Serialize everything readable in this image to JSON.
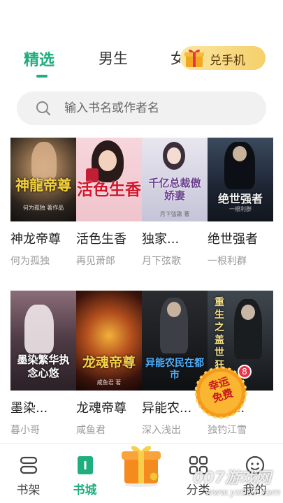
{
  "tabs": [
    {
      "label": "精选",
      "active": true
    },
    {
      "label": "男生",
      "active": false
    }
  ],
  "redeem_button": {
    "label": "兑手机"
  },
  "search": {
    "placeholder": "输入书名或作者名"
  },
  "books": [
    {
      "title": "神龙帝尊",
      "author": "何为孤独",
      "cover_text": "神龍帝尊",
      "cover_sub": "何为孤独 著作品"
    },
    {
      "title": "活色生香",
      "author": "再见萧郎",
      "cover_text": "活色生香",
      "cover_sub": ""
    },
    {
      "title": "独家...",
      "author": "月下弦歌",
      "cover_text": "千亿总裁傲娇妻",
      "cover_sub": "月下弦歌 著"
    },
    {
      "title": "绝世强者",
      "author": "一根利群",
      "cover_text": "绝世强者",
      "cover_sub": "一根利群"
    },
    {
      "title": "墨染...",
      "author": "暮小哥",
      "cover_text": "墨染繁华执念心悠",
      "cover_sub": ""
    },
    {
      "title": "龙魂帝尊",
      "author": "咸鱼君",
      "cover_text": "龙魂帝尊",
      "cover_sub": "咸鱼君 著"
    },
    {
      "title": "异能农...",
      "author": "深入浅出",
      "cover_text": "异能农民在都市",
      "cover_sub": ""
    },
    {
      "title": "重生...",
      "author": "独钓江雪",
      "cover_text": "重生之盖世狂",
      "cover_sub": ""
    }
  ],
  "float_badge": {
    "line1": "幸运",
    "line2": "免费",
    "count": "8"
  },
  "bottom_nav": [
    {
      "label": "书架",
      "icon": "bookshelf-icon",
      "active": false
    },
    {
      "label": "书城",
      "icon": "bookstore-icon",
      "active": true
    },
    {
      "label": "分类",
      "icon": "category-grid-icon",
      "active": false
    },
    {
      "label": "我的",
      "icon": "profile-face-icon",
      "active": false
    }
  ],
  "watermark": {
    "line1": "007游戏网",
    "line2": "www.yx007.com"
  },
  "colors": {
    "accent": "#1fae7e",
    "gold": "#f5d06a",
    "badge_orange": "#f59a1b",
    "badge_red": "#e8344a"
  }
}
